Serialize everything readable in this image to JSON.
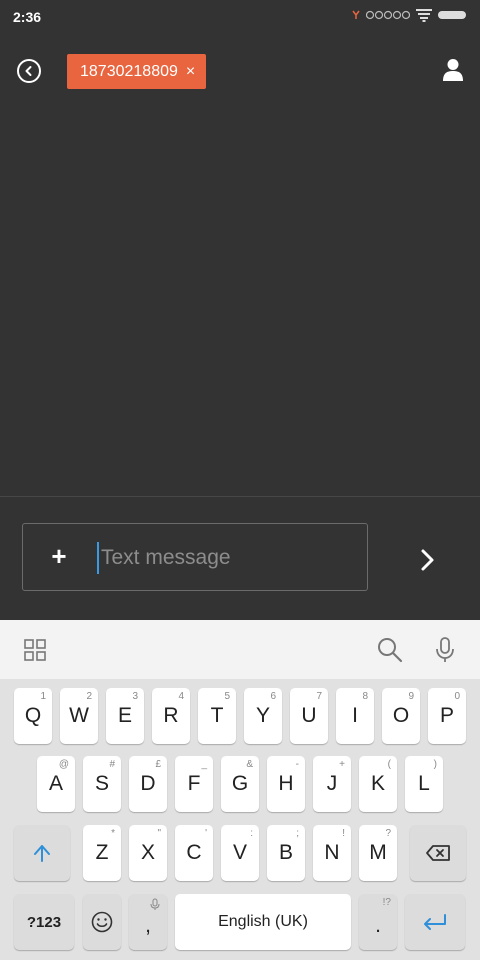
{
  "status_bar": {
    "time": "2:36"
  },
  "header": {
    "recipient": "18730218809",
    "remove_symbol": "×"
  },
  "compose": {
    "attach_symbol": "+",
    "placeholder": "Text message"
  },
  "keyboard": {
    "row1": [
      {
        "k": "Q",
        "h": "1"
      },
      {
        "k": "W",
        "h": "2"
      },
      {
        "k": "E",
        "h": "3"
      },
      {
        "k": "R",
        "h": "4"
      },
      {
        "k": "T",
        "h": "5"
      },
      {
        "k": "Y",
        "h": "6"
      },
      {
        "k": "U",
        "h": "7"
      },
      {
        "k": "I",
        "h": "8"
      },
      {
        "k": "O",
        "h": "9"
      },
      {
        "k": "P",
        "h": "0"
      }
    ],
    "row2": [
      {
        "k": "A",
        "h": "@"
      },
      {
        "k": "S",
        "h": "#"
      },
      {
        "k": "D",
        "h": "£"
      },
      {
        "k": "F",
        "h": "_"
      },
      {
        "k": "G",
        "h": "&"
      },
      {
        "k": "H",
        "h": "-"
      },
      {
        "k": "J",
        "h": "+"
      },
      {
        "k": "K",
        "h": "("
      },
      {
        "k": "L",
        "h": ")"
      }
    ],
    "row3": [
      {
        "k": "Z",
        "h": "*"
      },
      {
        "k": "X",
        "h": "\""
      },
      {
        "k": "C",
        "h": "'"
      },
      {
        "k": "V",
        "h": ":"
      },
      {
        "k": "B",
        "h": ";"
      },
      {
        "k": "N",
        "h": "!"
      },
      {
        "k": "M",
        "h": "?"
      }
    ],
    "symbols_label": "?123",
    "comma_label": ",",
    "space_label": "English (UK)",
    "period_label": ".",
    "period_hint": "!?"
  },
  "colors": {
    "background": "#333333",
    "chip": "#e8653f",
    "accent": "#3b9ae1"
  }
}
